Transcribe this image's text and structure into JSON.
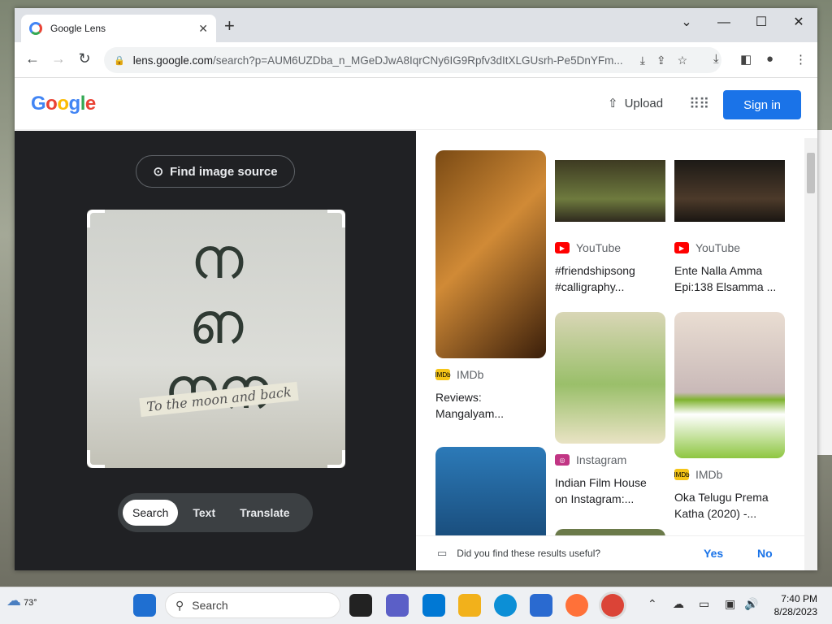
{
  "window": {
    "tab_title": "Google Lens",
    "new_tab": "+",
    "minimize": "⌄",
    "restore": "—",
    "maximize": "☐",
    "close": "✕"
  },
  "toolbar": {
    "url_host": "lens.google.com",
    "url_path": "/search?p=AUM6UZDba_n_MGeDJwA8IqrCNy6IG9Rpfv3dItXLGUsrh-Pe5DnYFm..."
  },
  "header": {
    "logo": [
      "G",
      "o",
      "o",
      "g",
      "l",
      "e"
    ],
    "upload_label": "Upload",
    "signin_label": "Sign in"
  },
  "lens": {
    "find_source_label": "Find image source",
    "image_tagline": "To the moon and back",
    "modes": [
      "Search",
      "Text",
      "Translate"
    ]
  },
  "results": [
    {
      "source": "IMDb",
      "caption_lines": [
        "Reviews:",
        "Mangalyam..."
      ]
    },
    {
      "source": "YouTube",
      "caption_lines": [
        "#friendshipsong",
        "#calligraphy..."
      ]
    },
    {
      "source": "YouTube",
      "caption_lines": [
        "Ente Nalla Amma",
        "Epi:138 Elsamma ..."
      ]
    },
    {
      "source": "Instagram",
      "caption_lines": [
        "Indian Film House",
        "on Instagram:..."
      ]
    },
    {
      "source": "IMDb",
      "caption_lines": [
        "Oka Telugu Prema",
        "Katha (2020) -..."
      ]
    }
  ],
  "feedback": {
    "question": "Did you find these results useful?",
    "yes": "Yes",
    "no": "No"
  },
  "taskbar": {
    "weather_temp": "73°",
    "search_label": "Search",
    "time": "7:40 PM",
    "date": "8/28/2023"
  },
  "colors": {
    "accent": "#1a73e8",
    "lens_dark": "#202124"
  }
}
